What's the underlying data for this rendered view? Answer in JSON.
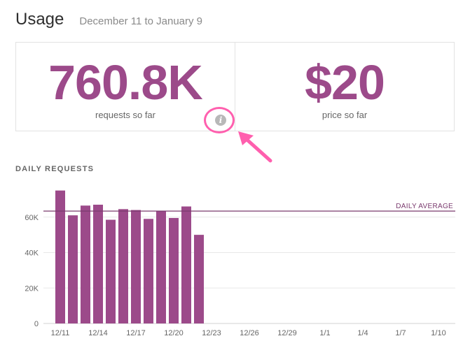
{
  "header": {
    "title": "Usage",
    "date_range": "December 11 to January 9"
  },
  "stats": {
    "requests": {
      "value": "760.8K",
      "label": "requests so far"
    },
    "price": {
      "value": "$20",
      "label": "price so far"
    }
  },
  "info_icon": {
    "glyph": "i",
    "icon": "info-icon"
  },
  "section_title": "DAILY REQUESTS",
  "colors": {
    "accent": "#9c4a8a",
    "highlight": "#ff5fae",
    "grid": "#e8e8e8"
  },
  "chart_data": {
    "type": "bar",
    "ylim": [
      0,
      80000
    ],
    "yticks": [
      {
        "value": 0,
        "label": "0"
      },
      {
        "value": 20000,
        "label": "20K"
      },
      {
        "value": 40000,
        "label": "40K"
      },
      {
        "value": 60000,
        "label": "60K"
      }
    ],
    "xticks": [
      "12/11",
      "12/14",
      "12/17",
      "12/20",
      "12/23",
      "12/26",
      "12/29",
      "1/1",
      "1/4",
      "1/7",
      "1/10"
    ],
    "days": [
      "12/11",
      "12/12",
      "12/13",
      "12/14",
      "12/15",
      "12/16",
      "12/17",
      "12/18",
      "12/19",
      "12/20",
      "12/21",
      "12/22",
      "12/23",
      "12/24",
      "12/25",
      "12/26",
      "12/27",
      "12/28",
      "12/29",
      "12/30",
      "12/31",
      "1/1",
      "1/2",
      "1/3",
      "1/4",
      "1/5",
      "1/6",
      "1/7",
      "1/8",
      "1/9",
      "1/10"
    ],
    "values": [
      75000,
      61000,
      66500,
      67000,
      58500,
      64500,
      64000,
      59000,
      63500,
      59500,
      66000,
      50000
    ],
    "reference_line": {
      "label": "DAILY AVERAGE",
      "value": 63400
    }
  }
}
